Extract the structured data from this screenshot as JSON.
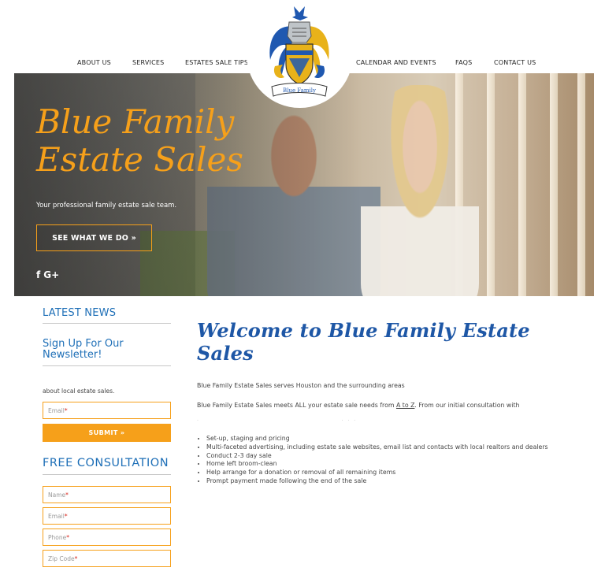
{
  "nav": {
    "items": [
      "ABOUT US",
      "SERVICES",
      "ESTATES SALE TIPS",
      "CALENDAR AND EVENTS",
      "FAQS",
      "CONTACT US"
    ]
  },
  "logo": {
    "banner_text": "Blue Family"
  },
  "hero": {
    "title_line1": "Blue Family",
    "title_line2": "Estate Sales",
    "subtitle": "Your professional family estate sale team.",
    "button_label": "SEE WHAT WE DO »",
    "social": [
      "f",
      "G+"
    ]
  },
  "sidebar": {
    "latest_news_heading": "LATEST NEWS",
    "newsletter_heading": "Sign Up For Our Newsletter!",
    "newsletter_text": "about local estate sales.",
    "newsletter_email_placeholder": "Email",
    "submit_label": "SUBMIT »",
    "consultation_heading": "FREE CONSULTATION",
    "consultation_fields": [
      "Name",
      "Email",
      "Phone",
      "Zip Code"
    ],
    "required_mark": "*"
  },
  "main": {
    "heading": "Welcome to Blue Family Estate Sales",
    "para1": "Blue Family Estate Sales serves Houston and the surrounding areas",
    "para2_before": "Blue Family Estate Sales meets ALL your estate sale needs from ",
    "para2_link": "A to Z",
    "para2_after": ". From our initial consultation with",
    "bullets": [
      "Set-up, staging and pricing",
      "Multi-faceted advertising, including estate sale websites, email list and contacts with local realtors and dealers",
      "Conduct 2-3 day sale",
      "Home left broom-clean",
      "Help arrange for a donation or removal of all remaining items",
      "Prompt payment made following the end of the sale"
    ]
  },
  "colors": {
    "accent_orange": "#f6a01a",
    "brand_blue": "#1e6fb7",
    "heading_blue": "#1e57a6"
  }
}
